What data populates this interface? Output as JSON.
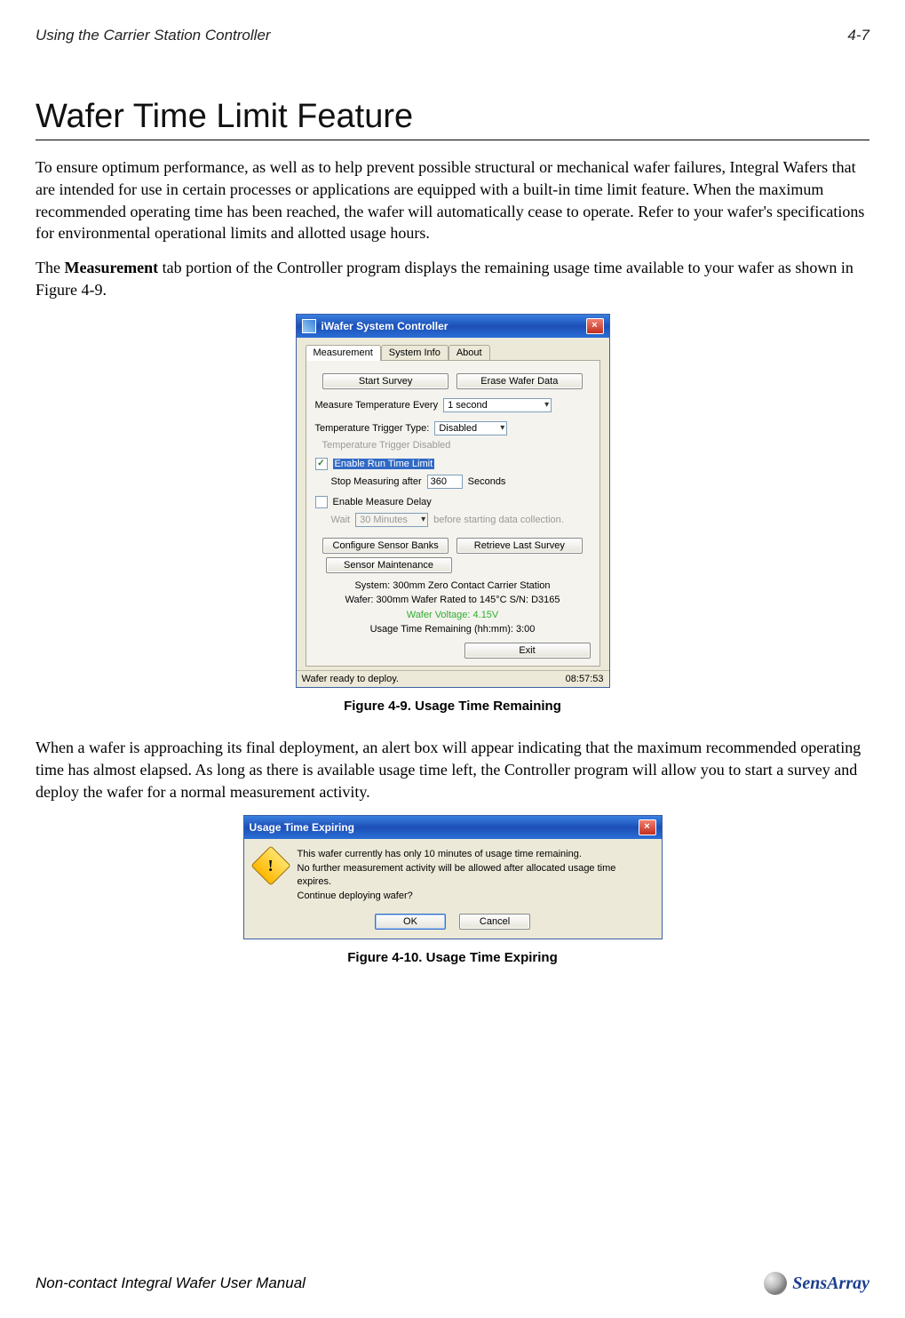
{
  "pageHeader": {
    "left": "Using the Carrier Station Controller",
    "right": "4-7"
  },
  "sectionTitle": "Wafer Time Limit Feature",
  "paragraph1": "To ensure optimum performance, as well as to help prevent possible structural or mechanical wafer failures, Integral Wafers that are intended for use in certain processes or applications are equipped with a built-in time limit feature.  When the maximum recommended operating time has been reached, the wafer will automatically cease to operate.  Refer to your wafer's specifications for environmental operational limits and allotted usage hours.",
  "paragraph2a": "The ",
  "paragraph2b": "Measurement",
  "paragraph2c": " tab portion of the Controller program displays the remaining usage time available to your wafer as shown in Figure 4-9.",
  "figure1": {
    "caption": "Figure 4-9. Usage Time Remaining"
  },
  "paragraph3": "When a wafer is approaching its final deployment, an alert box will appear indicating that the maximum recommended operating time has almost elapsed.  As long as there is available usage time left, the Controller program will allow you to start a survey and deploy the wafer for a normal measurement activity.",
  "figure2": {
    "caption": "Figure 4-10. Usage Time Expiring"
  },
  "footer": {
    "text": "Non-contact Integral Wafer User Manual",
    "logoText": "SensArray"
  },
  "window1": {
    "title": "iWafer System Controller",
    "tabs": [
      "Measurement",
      "System Info",
      "About"
    ],
    "buttons": {
      "startSurvey": "Start Survey",
      "eraseWafer": "Erase Wafer Data",
      "configureBanks": "Configure Sensor Banks",
      "retrieveLast": "Retrieve Last Survey",
      "sensorMaint": "Sensor Maintenance",
      "exit": "Exit"
    },
    "labels": {
      "measureEvery": "Measure Temperature Every",
      "measureEveryValue": "1 second",
      "triggerType": "Temperature Trigger Type:",
      "triggerTypeValue": "Disabled",
      "triggerDisabled": "Temperature Trigger Disabled",
      "enableRunTime": "Enable Run Time Limit",
      "stopMeasuring": "Stop Measuring after",
      "stopMeasuringValue": "360",
      "seconds": "Seconds",
      "enableDelay": "Enable Measure Delay",
      "wait": "Wait",
      "waitValue": "30 Minutes",
      "beforeCollect": "before starting data collection."
    },
    "info": {
      "system": "System: 300mm Zero Contact Carrier Station",
      "wafer": "Wafer: 300mm Wafer Rated to 145°C S/N: D3165",
      "voltage": "Wafer Voltage: 4.15V",
      "usage": "Usage Time Remaining (hh:mm): 3:00"
    },
    "status": {
      "left": "Wafer ready to deploy.",
      "right": "08:57:53"
    }
  },
  "window2": {
    "title": "Usage Time Expiring",
    "line1": "This wafer currently has only 10 minutes of usage time remaining.",
    "line2": "No further measurement activity will be allowed after allocated usage time expires.",
    "line3": "Continue deploying wafer?",
    "ok": "OK",
    "cancel": "Cancel"
  }
}
